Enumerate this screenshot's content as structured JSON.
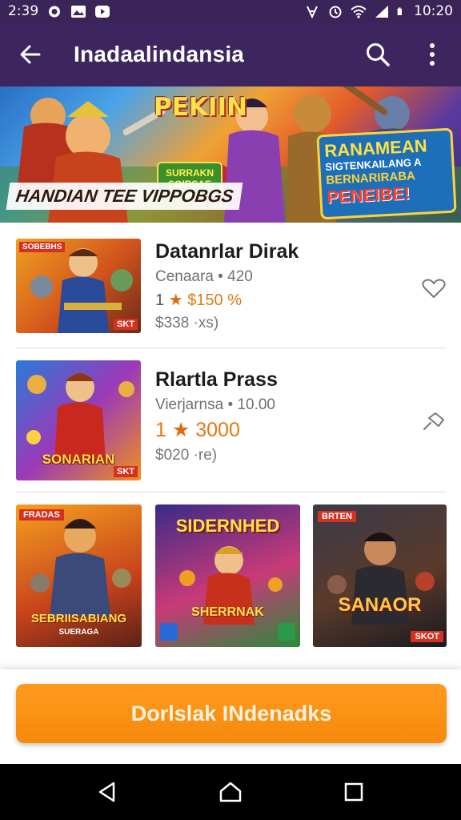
{
  "status_bar": {
    "time": "2:39",
    "clock": "10:20"
  },
  "app_bar": {
    "title": "Inadaalindansia"
  },
  "banner": {
    "top_title": "PEKIIN",
    "small_badge": "SURRAKN SOIRSAE",
    "bottom_text": "HANDIAN TEE VIPPOBGS",
    "right_line1": "RANAMEAN",
    "right_line2": "SIGTENKAILANG A",
    "right_line3": "BERNARIRABA",
    "right_line4": "PENEIBE!"
  },
  "items": [
    {
      "tag": "SOBEBHS",
      "corner": "SKT",
      "name": "Datanrlar Dirak",
      "developer": "Cenaara • 420",
      "rating_prefix": "1",
      "rating_value": "$150 %",
      "price": "$338 ·xs)"
    },
    {
      "caption": "SONARIAN",
      "corner": "SKT",
      "name": "Rlartla Prass",
      "developer": "Vierjarnsa • 10.00",
      "rating_prefix": "1",
      "rating_value": "3000",
      "price": "$020 ·re)"
    }
  ],
  "grid": [
    {
      "tag": "FRADAS",
      "caption": "SEBRIISABIANG",
      "subcaption": "SUERAGA"
    },
    {
      "title": "SIDERNHED",
      "caption": "SHERRNAK"
    },
    {
      "tag": "BRTEN",
      "caption": "SANAOR",
      "corner": "SKOT"
    }
  ],
  "cta": {
    "label": "Dorlslak INdenadks"
  },
  "colors": {
    "app_bar": "#3d2660",
    "accent": "#f58a0c",
    "star": "#e06a10"
  },
  "icons": {
    "back": "arrow-left-icon",
    "search": "search-icon",
    "more": "more-vert-icon",
    "favorite": "heart-outline-icon",
    "pin": "pin-icon",
    "nav_back": "triangle-back-icon",
    "nav_home": "home-icon",
    "nav_recent": "square-recent-icon"
  }
}
